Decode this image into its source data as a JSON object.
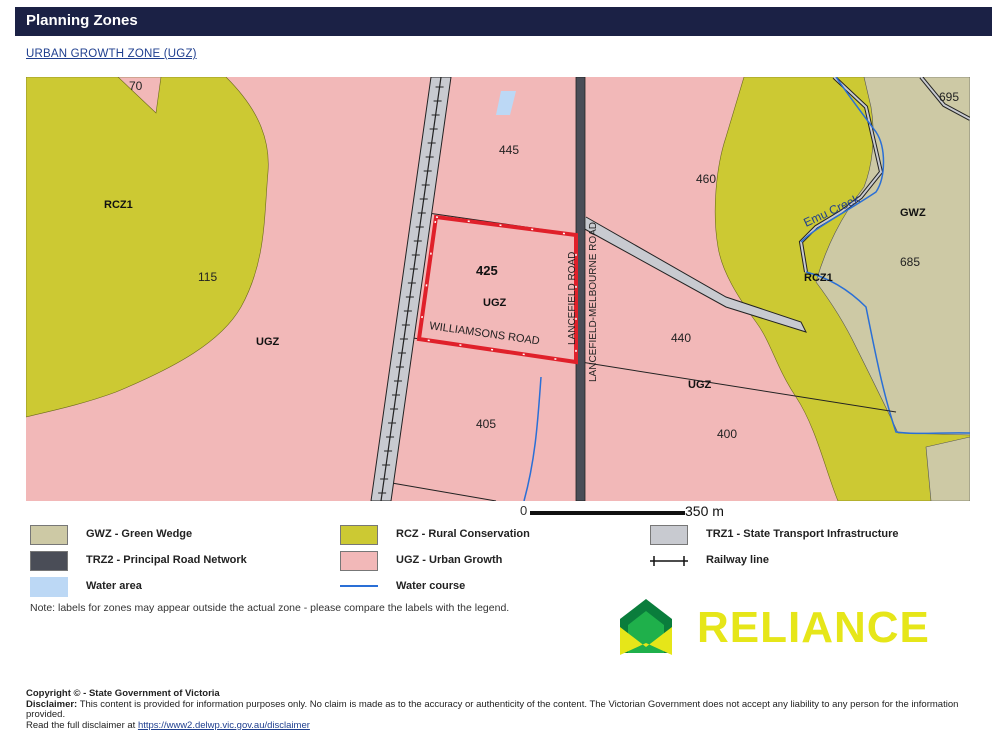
{
  "header": {
    "title": "Planning Zones"
  },
  "zone_link": "URBAN GROWTH ZONE (UGZ)",
  "map": {
    "labels": {
      "lot_70": "70",
      "lot_695": "695",
      "lot_445": "445",
      "lot_460": "460",
      "rcz1_west": "RCZ1",
      "gwz": "GWZ",
      "emu_creek": "Emu Creek",
      "lot_685": "685",
      "lot_115": "115",
      "lot_425": "425",
      "ugz_center": "UGZ",
      "rcz1_east": "RCZ1",
      "ugz_west": "UGZ",
      "williamsons_road": "WILLIAMSONS ROAD",
      "lancefield_road": "LANCEFIELD ROAD",
      "lancefield_melbourne_road": "LANCEFIELD-MELBOURNE ROAD",
      "lot_440": "440",
      "ugz_east": "UGZ",
      "lot_405": "405",
      "lot_400": "400"
    },
    "colors": {
      "ugz": "#f2b8b8",
      "rcz": "#ccc933",
      "gwz": "#cdc9a5",
      "trz1": "#c8cad0",
      "trz2": "#4a4d57",
      "water": "#bcd8f5",
      "watercourse": "#2a6fd6",
      "subject_outline": "#e0202a"
    }
  },
  "scale": {
    "zero": "0",
    "label": "350 m"
  },
  "legend": {
    "gwz": "GWZ - Green Wedge",
    "rcz": "RCZ - Rural Conservation",
    "trz1": "TRZ1 - State Transport Infrastructure",
    "trz2": "TRZ2 - Principal Road Network",
    "ugz": "UGZ - Urban Growth",
    "railway": "Railway line",
    "water_area": "Water area",
    "water_course": "Water course"
  },
  "note": "Note: labels for zones may appear outside the actual zone - please compare the labels with the legend.",
  "logo": {
    "text": "RELIANCE"
  },
  "footer": {
    "copyright": "Copyright © - State Government of Victoria",
    "disclaimer_label": "Disclaimer:",
    "disclaimer_text": "This content is provided for information purposes only. No claim is made as to the accuracy or authenticity of the content. The Victorian Government does not accept any liability to any person for the information provided.",
    "read_prefix": "Read the full disclaimer at",
    "disclaimer_url": "https://www2.delwp.vic.gov.au/disclaimer"
  }
}
